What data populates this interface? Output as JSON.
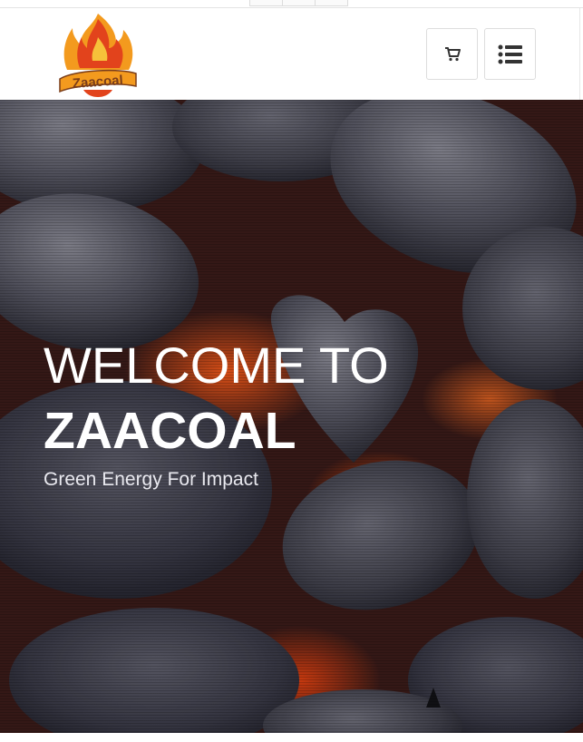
{
  "header": {
    "logo_text": "Zaacoal",
    "cart_icon": "cart-icon",
    "menu_icon": "list-menu-icon"
  },
  "hero": {
    "welcome": "WELCOME TO",
    "brand": "ZAACOAL",
    "tagline": "Green Energy For Impact"
  },
  "colors": {
    "flame_orange": "#f39a1e",
    "flame_red": "#e2431c",
    "logo_text": "#7a3d1a",
    "ember": "#ff5a14"
  }
}
